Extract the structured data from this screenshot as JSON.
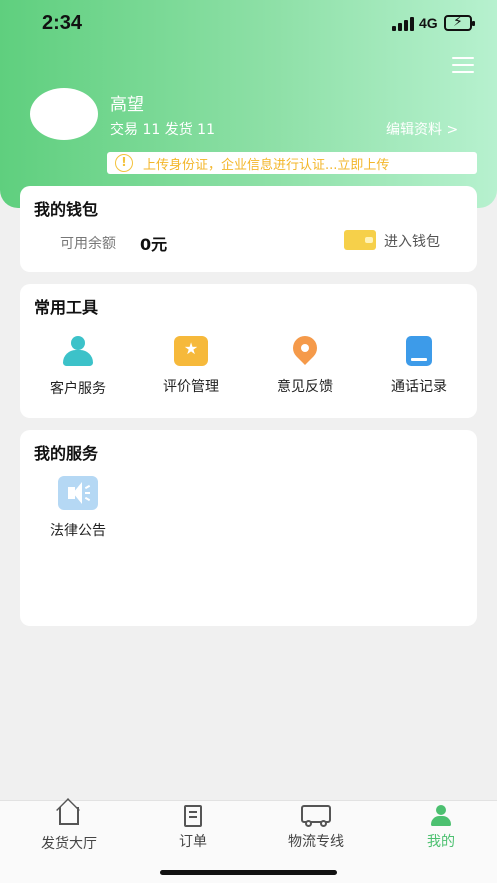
{
  "status_bar": {
    "time": "2:34",
    "network": "4G"
  },
  "profile": {
    "name": "高望",
    "stats": "交易 11  发货 11",
    "edit_label": "编辑资料 >"
  },
  "notice": {
    "icon_text": "!",
    "text": "上传身份证，企业信息进行认证...立即上传"
  },
  "wallet": {
    "title": "我的钱包",
    "balance_label": "可用余额",
    "balance_value": "0元",
    "enter_label": "进入钱包"
  },
  "tools": {
    "title": "常用工具",
    "items": [
      {
        "label": "客户服务",
        "icon": "customer-service-icon"
      },
      {
        "label": "评价管理",
        "icon": "star-icon"
      },
      {
        "label": "意见反馈",
        "icon": "feedback-pin-icon"
      },
      {
        "label": "通话记录",
        "icon": "call-log-icon"
      }
    ]
  },
  "services": {
    "title": "我的服务",
    "items": [
      {
        "label": "法律公告",
        "icon": "speaker-icon"
      }
    ]
  },
  "tabbar": {
    "items": [
      {
        "label": "发货大厅",
        "icon": "home-icon",
        "active": false
      },
      {
        "label": "订单",
        "icon": "document-icon",
        "active": false
      },
      {
        "label": "物流专线",
        "icon": "truck-icon",
        "active": false
      },
      {
        "label": "我的",
        "icon": "person-icon",
        "active": true
      }
    ]
  },
  "colors": {
    "accent": "#4cc070",
    "header_start": "#5fcf7e",
    "header_end": "#b7f1cf",
    "notice": "#f3b62a"
  }
}
